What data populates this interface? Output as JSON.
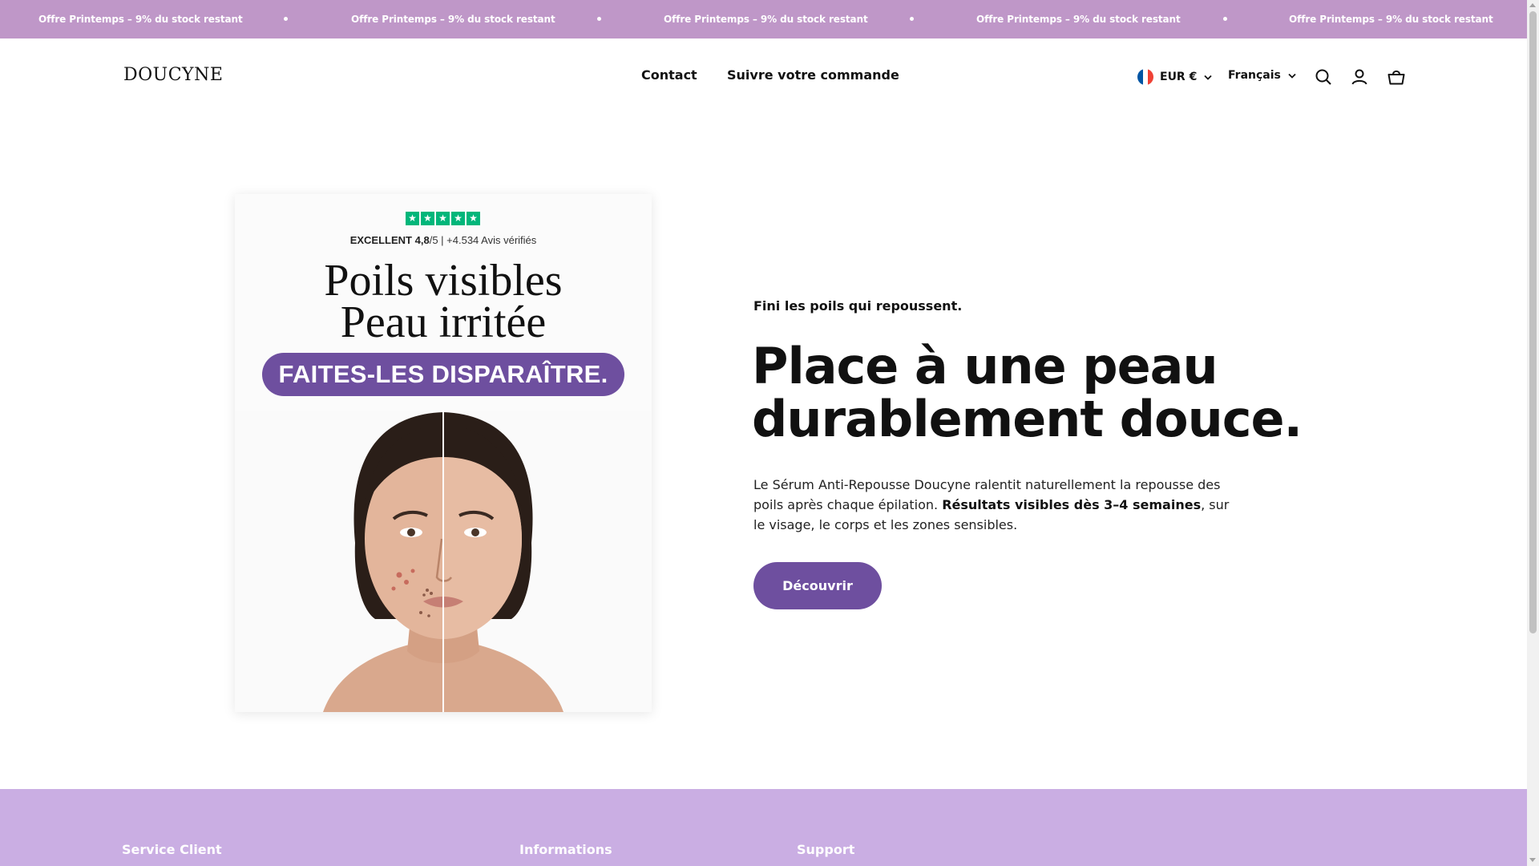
{
  "announcement": {
    "items": [
      "Offre Printemps – 9% du stock restant",
      "Offre Printemps – 9% du stock restant",
      "Offre Printemps – 9% du stock restant",
      "Offre Printemps – 9% du stock restant",
      "Offre Printemps – 9% du stock restant"
    ],
    "background_color": "#bf97c8"
  },
  "header": {
    "logo": "DOUCYNE",
    "nav": [
      "Contact",
      "Suivre votre commande"
    ],
    "currency": "EUR €",
    "language": "Français",
    "icons": [
      "search-icon",
      "account-icon",
      "cart-icon"
    ]
  },
  "hero_image": {
    "rating_label": "EXCELLENT",
    "rating_value": "4,8",
    "rating_scale": "/5",
    "rating_reviews": "+4.534 Avis vérifiés",
    "stars": 5,
    "headline_line1": "Poils visibles",
    "headline_line2": "Peau irritée",
    "pill": "FAITES-LES DISPARAÎTRE."
  },
  "hero": {
    "eyebrow": "Fini les poils qui repoussent.",
    "title_line1": "Place à une peau",
    "title_line2": "durablement douce.",
    "body_prefix": "Le Sérum Anti-Repousse Doucyne ralentit naturellement la repousse des poils après chaque épilation. ",
    "body_bold": "Résultats visibles dès 3–4 semaines",
    "body_suffix": ", sur le visage, le corps et les zones sensibles.",
    "cta": "Découvrir",
    "accent_color": "#6e4f9f"
  },
  "footer": {
    "headings": [
      "Service Client",
      "Informations",
      "Support"
    ],
    "background_color": "#caaee3"
  }
}
